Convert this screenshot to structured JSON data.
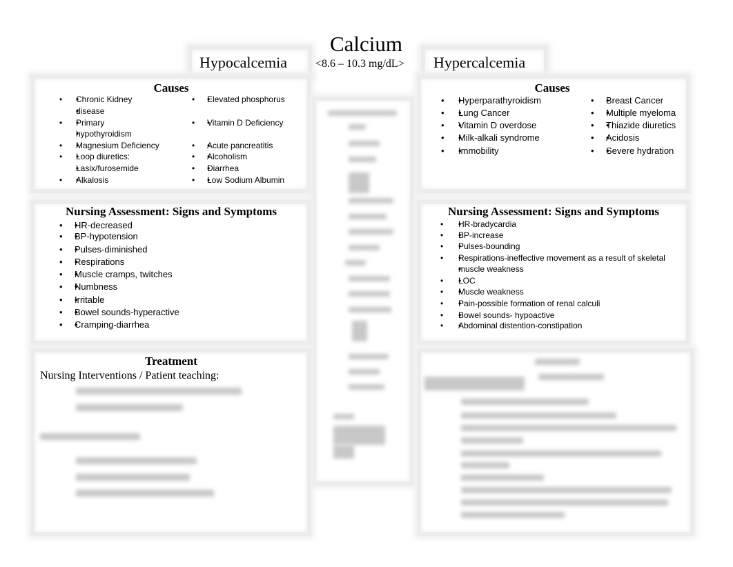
{
  "header": {
    "title": "Calcium",
    "left_condition": "Hypocalcemia",
    "range": "<8.6 – 10.3 mg/dL>",
    "right_condition": "Hypercalcemia"
  },
  "hypo": {
    "causes_title": "Causes",
    "causes_col1": [
      "Chronic Kidney",
      "disease",
      "Primary",
      "hypothyroidism",
      "Magnesium Deficiency",
      "Loop diuretics:",
      "Lasix/furosemide",
      "Alkalosis"
    ],
    "causes_col2": [
      "Elevated phosphorus",
      "Vitamin D Deficiency",
      "Acute pancreatitis",
      "Alcoholism",
      "Diarrhea",
      "Low Sodium Albumin"
    ],
    "assessment_title": "Nursing Assessment: Signs and Symptoms",
    "assessment": [
      "HR-decreased",
      "BP-hypotension",
      "Pulses-diminished",
      "Respirations",
      "Muscle cramps, twitches",
      "Numbness",
      "Irritable",
      "Bowel sounds-hyperactive",
      "Cramping-diarrhea"
    ],
    "treatment_title": "Treatment",
    "treatment_subtitle": "Nursing Interventions / Patient teaching:"
  },
  "hyper": {
    "causes_title": "Causes",
    "causes_col1": [
      "Hyperparathyroidism",
      "Lung Cancer",
      "Vitamin D overdose",
      "Milk-alkali syndrome",
      "Immobility"
    ],
    "causes_col2": [
      "Breast Cancer",
      "Multiple myeloma",
      "Thiazide diuretics",
      "Acidosis",
      "Severe hydration"
    ],
    "assessment_title": "Nursing Assessment: Signs and Symptoms",
    "assessment": [
      "HR-bradycardia",
      "BP-increase",
      "Pulses-bounding",
      "Respirations-ineffective movement as a result of skeletal",
      "muscle weakness",
      "LOC",
      "Muscle weakness",
      "Pain-possible formation of renal calculi",
      "Bowel sounds- hypoactive",
      "Abdominal distention-constipation"
    ]
  }
}
